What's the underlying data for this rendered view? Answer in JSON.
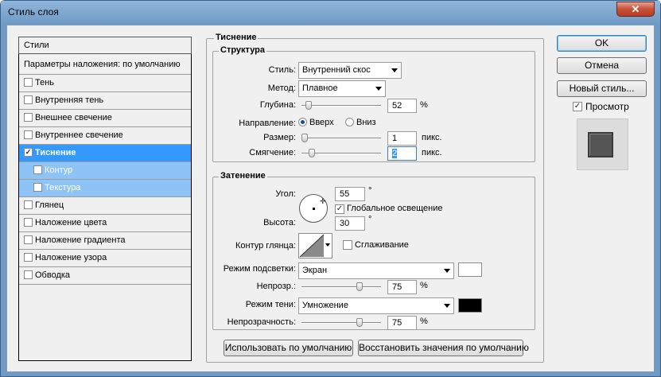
{
  "window": {
    "title": "Стиль слоя",
    "close_glyph": "✕"
  },
  "styles_list": {
    "header": "Стили",
    "blend_defaults": "Параметры наложения: по умолчанию",
    "items": [
      {
        "label": "Тень",
        "checked": false
      },
      {
        "label": "Внутренняя тень",
        "checked": false
      },
      {
        "label": "Внешнее свечение",
        "checked": false
      },
      {
        "label": "Внутреннее свечение",
        "checked": false
      },
      {
        "label": "Тиснение",
        "checked": true,
        "selected": true
      },
      {
        "label": "Контур",
        "checked": false,
        "sub": true
      },
      {
        "label": "Текстура",
        "checked": false,
        "sub": true
      },
      {
        "label": "Глянец",
        "checked": false
      },
      {
        "label": "Наложение цвета",
        "checked": false
      },
      {
        "label": "Наложение градиента",
        "checked": false
      },
      {
        "label": "Наложение узора",
        "checked": false
      },
      {
        "label": "Обводка",
        "checked": false
      }
    ]
  },
  "bevel": {
    "title": "Тиснение",
    "structure": {
      "title": "Структура",
      "style_label": "Стиль:",
      "style_value": "Внутренний скос",
      "method_label": "Метод:",
      "method_value": "Плавное",
      "depth_label": "Глубина:",
      "depth_value": "52",
      "depth_unit": "%",
      "depth_pct": 0.05,
      "direction_label": "Направление:",
      "dir_up": "Вверх",
      "dir_down": "Вниз",
      "direction": "up",
      "size_label": "Размер:",
      "size_value": "1",
      "size_unit": "пикс.",
      "size_pct": 0.0,
      "soften_label": "Смягчение:",
      "soften_value": "2",
      "soften_unit": "пикс.",
      "soften_pct": 0.1
    },
    "shading": {
      "title": "Затенение",
      "angle_label": "Угол:",
      "angle_value": "55",
      "angle_unit": "°",
      "global_light": "Глобальное освещение",
      "global_light_checked": true,
      "altitude_label": "Высота:",
      "altitude_value": "30",
      "altitude_unit": "°",
      "gloss_label": "Контур глянца:",
      "antialias": "Сглаживание",
      "antialias_checked": false,
      "highlight_label": "Режим подсветки:",
      "highlight_value": "Экран",
      "highlight_color": "#ffffff",
      "hl_opacity_label": "Непрозр.:",
      "hl_opacity_value": "75",
      "hl_opacity_unit": "%",
      "hl_opacity_pct": 0.75,
      "shadow_label": "Режим тени:",
      "shadow_value": "Умножение",
      "shadow_color": "#000000",
      "sh_opacity_label": "Непрозрачность:",
      "sh_opacity_value": "75",
      "sh_opacity_unit": "%",
      "sh_opacity_pct": 0.75
    },
    "use_default": "Использовать по умолчанию",
    "reset_default": "Восстановить значения по умолчанию"
  },
  "buttons": {
    "ok": "OK",
    "cancel": "Отмена",
    "new_style": "Новый стиль...",
    "preview": "Просмотр",
    "preview_checked": true
  }
}
